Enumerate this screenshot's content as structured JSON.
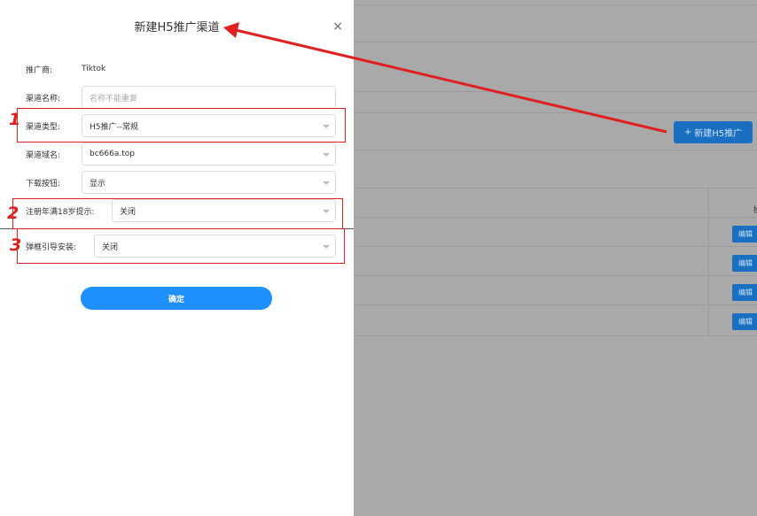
{
  "dialog": {
    "title": "新建H5推广渠道",
    "close_icon": "×",
    "fields": [
      {
        "label": "推广商:",
        "value": "Tiktok",
        "kind": "text"
      },
      {
        "label": "渠道名称:",
        "placeholder": "名称不能重复",
        "kind": "input"
      },
      {
        "label": "渠道类型:",
        "value": "H5推广--常规",
        "kind": "select"
      },
      {
        "label": "渠道域名:",
        "value": "bc666a.top",
        "kind": "select"
      },
      {
        "label": "下载按钮:",
        "value": "显示",
        "kind": "select"
      },
      {
        "label": "注册年满18岁提示:",
        "value": "关闭",
        "kind": "select"
      },
      {
        "label": "弹框引导安装:",
        "value": "关闭",
        "kind": "select"
      }
    ],
    "confirm_label": "确定"
  },
  "background": {
    "new_button_icon": "+",
    "new_button_label": "新建H5推广",
    "edit_label": "编辑",
    "column_head": "操"
  },
  "annotations": {
    "labels": [
      "1",
      "2",
      "3"
    ],
    "color": "#e02020"
  }
}
